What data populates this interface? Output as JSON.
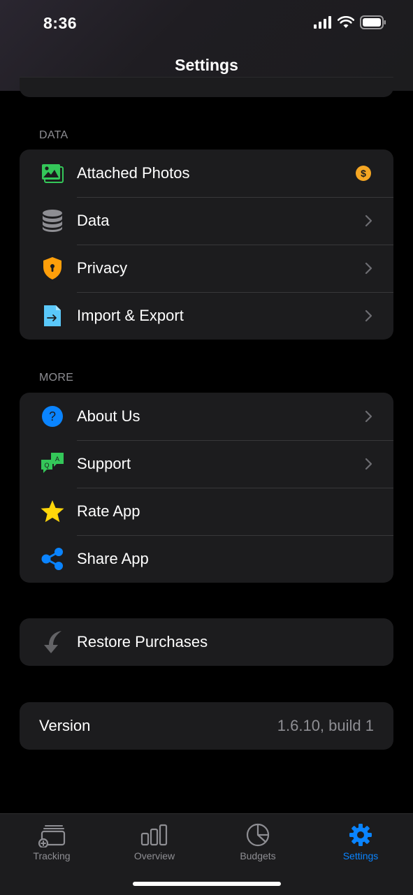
{
  "status": {
    "time": "8:36"
  },
  "nav": {
    "title": "Settings"
  },
  "data_section": {
    "header": "DATA",
    "items": [
      {
        "label": "Attached Photos",
        "icon": "photos-icon",
        "accessory": "coin"
      },
      {
        "label": "Data",
        "icon": "database-icon",
        "accessory": "chevron"
      },
      {
        "label": "Privacy",
        "icon": "shield-lock-icon",
        "accessory": "chevron"
      },
      {
        "label": "Import & Export",
        "icon": "import-export-icon",
        "accessory": "chevron"
      }
    ]
  },
  "more_section": {
    "header": "MORE",
    "items": [
      {
        "label": "About Us",
        "icon": "question-icon",
        "accessory": "chevron"
      },
      {
        "label": "Support",
        "icon": "chat-bubbles-icon",
        "accessory": "chevron"
      },
      {
        "label": "Rate App",
        "icon": "star-icon",
        "accessory": "none"
      },
      {
        "label": "Share App",
        "icon": "share-icon",
        "accessory": "none"
      }
    ]
  },
  "restore": {
    "label": "Restore Purchases"
  },
  "version": {
    "label": "Version",
    "value": "1.6.10, build 1"
  },
  "tabs": [
    {
      "label": "Tracking",
      "active": false
    },
    {
      "label": "Overview",
      "active": false
    },
    {
      "label": "Budgets",
      "active": false
    },
    {
      "label": "Settings",
      "active": true
    }
  ],
  "colors": {
    "background": "#000000",
    "card": "#1c1c1e",
    "accent": "#0a84ff",
    "secondary_text": "#8e8e93",
    "coin": "#f5a623",
    "green": "#34c759",
    "orange": "#ff9f0a",
    "yellow": "#ffd60a"
  }
}
